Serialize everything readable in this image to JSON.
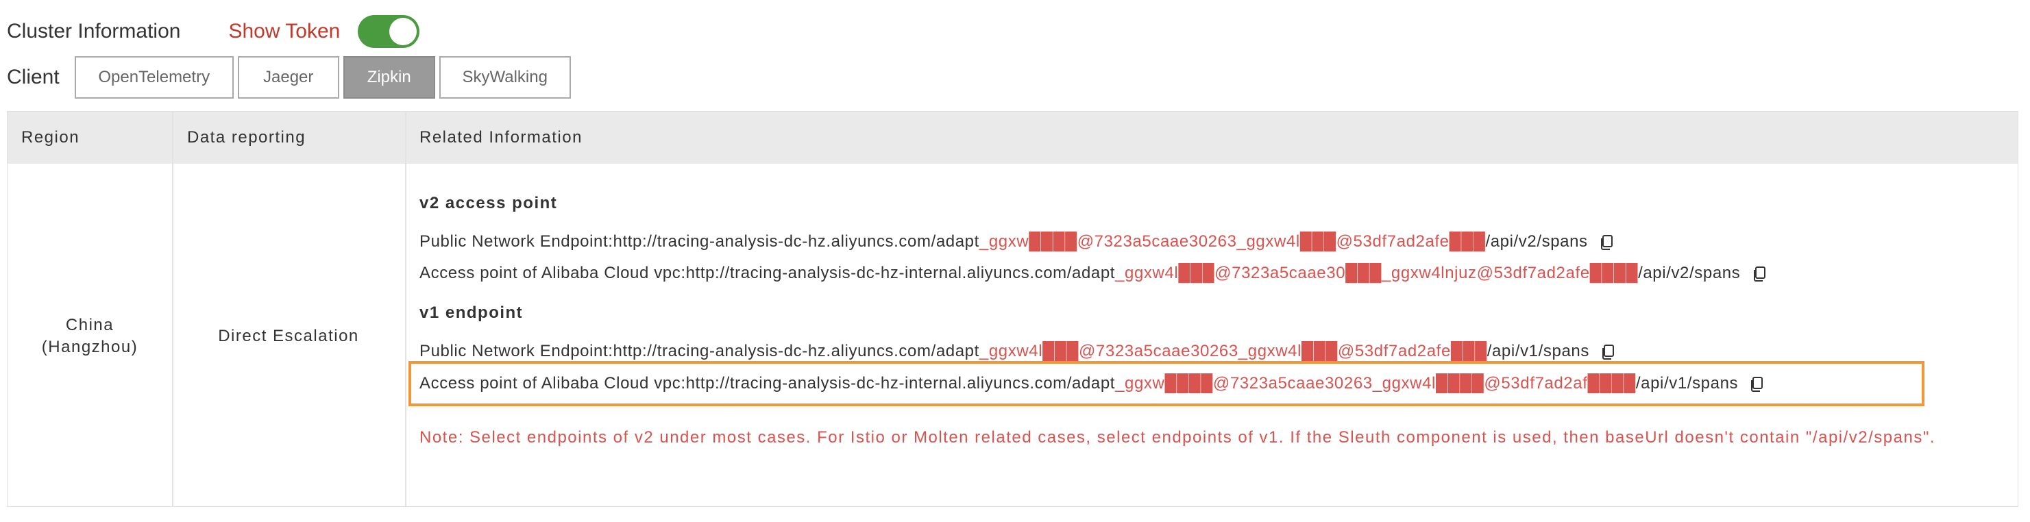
{
  "header": {
    "cluster_title": "Cluster Information",
    "show_token_label": "Show Token",
    "show_token_enabled": true
  },
  "client": {
    "label": "Client",
    "tabs": [
      {
        "label": "OpenTelemetry",
        "active": false
      },
      {
        "label": "Jaeger",
        "active": false
      },
      {
        "label": "Zipkin",
        "active": true
      },
      {
        "label": "SkyWalking",
        "active": false
      }
    ]
  },
  "table": {
    "headers": [
      "Region",
      "Data reporting",
      "Related Information"
    ],
    "region": "China\n(Hangzhou)",
    "data_reporting": "Direct Escalation",
    "v2": {
      "title": "v2 access point",
      "public": {
        "prefix": "Public Network Endpoint:http://tracing-analysis-dc-hz.aliyuncs.com/adapt",
        "token": "_ggxw████@7323a5caae30263_ggxw4l███@53df7ad2afe███",
        "suffix": "/api/v2/spans"
      },
      "vpc": {
        "prefix": "Access point of Alibaba Cloud vpc:http://tracing-analysis-dc-hz-internal.aliyuncs.com/adapt",
        "token": "_ggxw4l███@7323a5caae30███_ggxw4lnjuz@53df7ad2afe████",
        "suffix": "/api/v2/spans"
      }
    },
    "v1": {
      "title": "v1 endpoint",
      "public": {
        "prefix": "Public Network Endpoint:http://tracing-analysis-dc-hz.aliyuncs.com/adapt",
        "token": "_ggxw4l███@7323a5caae30263_ggxw4l███@53df7ad2afe███",
        "suffix": "/api/v1/spans"
      },
      "vpc": {
        "prefix": "Access point of Alibaba Cloud vpc:http://tracing-analysis-dc-hz-internal.aliyuncs.com/adapt",
        "token": "_ggxw████@7323a5caae30263_ggxw4l████@53df7ad2af████",
        "suffix": "/api/v1/spans"
      }
    },
    "note": "Note: Select endpoints of v2 under most cases. For Istio or Molten related cases, select endpoints of v1. If the Sleuth component is used, then baseUrl doesn't contain \"/api/v2/spans\"."
  },
  "colors": {
    "toggle_on": "#4a9a3f",
    "token_text": "#d9534f",
    "highlight_border": "#f0973a",
    "active_tab": "#9a9a9a",
    "header_bg": "#eaeaea"
  },
  "icons": {
    "copy": "copy-icon"
  }
}
